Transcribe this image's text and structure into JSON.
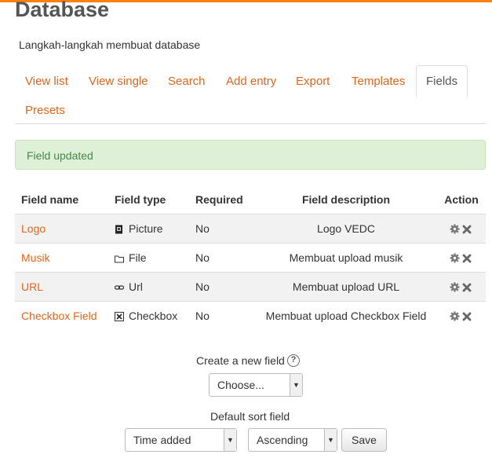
{
  "page": {
    "title": "Database",
    "intro": "Langkah-langkah membuat database"
  },
  "tabs": [
    {
      "label": "View list",
      "active": false
    },
    {
      "label": "View single",
      "active": false
    },
    {
      "label": "Search",
      "active": false
    },
    {
      "label": "Add entry",
      "active": false
    },
    {
      "label": "Export",
      "active": false
    },
    {
      "label": "Templates",
      "active": false
    },
    {
      "label": "Fields",
      "active": true
    },
    {
      "label": "Presets",
      "active": false
    }
  ],
  "alert": {
    "message": "Field updated"
  },
  "table": {
    "headers": {
      "name": "Field name",
      "type": "Field type",
      "required": "Required",
      "description": "Field description",
      "action": "Action"
    },
    "rows": [
      {
        "name": "Logo",
        "type": "Picture",
        "type_icon": "picture-icon",
        "required": "No",
        "description": "Logo VEDC"
      },
      {
        "name": "Musik",
        "type": "File",
        "type_icon": "folder-icon",
        "required": "No",
        "description": "Membuat upload musik"
      },
      {
        "name": "URL",
        "type": "Url",
        "type_icon": "link-icon",
        "required": "No",
        "description": "Membuat upload URL"
      },
      {
        "name": "Checkbox Field",
        "type": "Checkbox",
        "type_icon": "checkbox-icon",
        "required": "No",
        "description": "Membuat upload Checkbox Field"
      }
    ]
  },
  "create_field": {
    "label": "Create a new field",
    "select_value": "Choose..."
  },
  "sort": {
    "label": "Default sort field",
    "field_value": "Time added",
    "order_value": "Ascending",
    "save_label": "Save"
  },
  "colors": {
    "accent": "#f98012",
    "link": "#e5641c",
    "alert_bg": "#dff0d8",
    "alert_text": "#468847"
  }
}
